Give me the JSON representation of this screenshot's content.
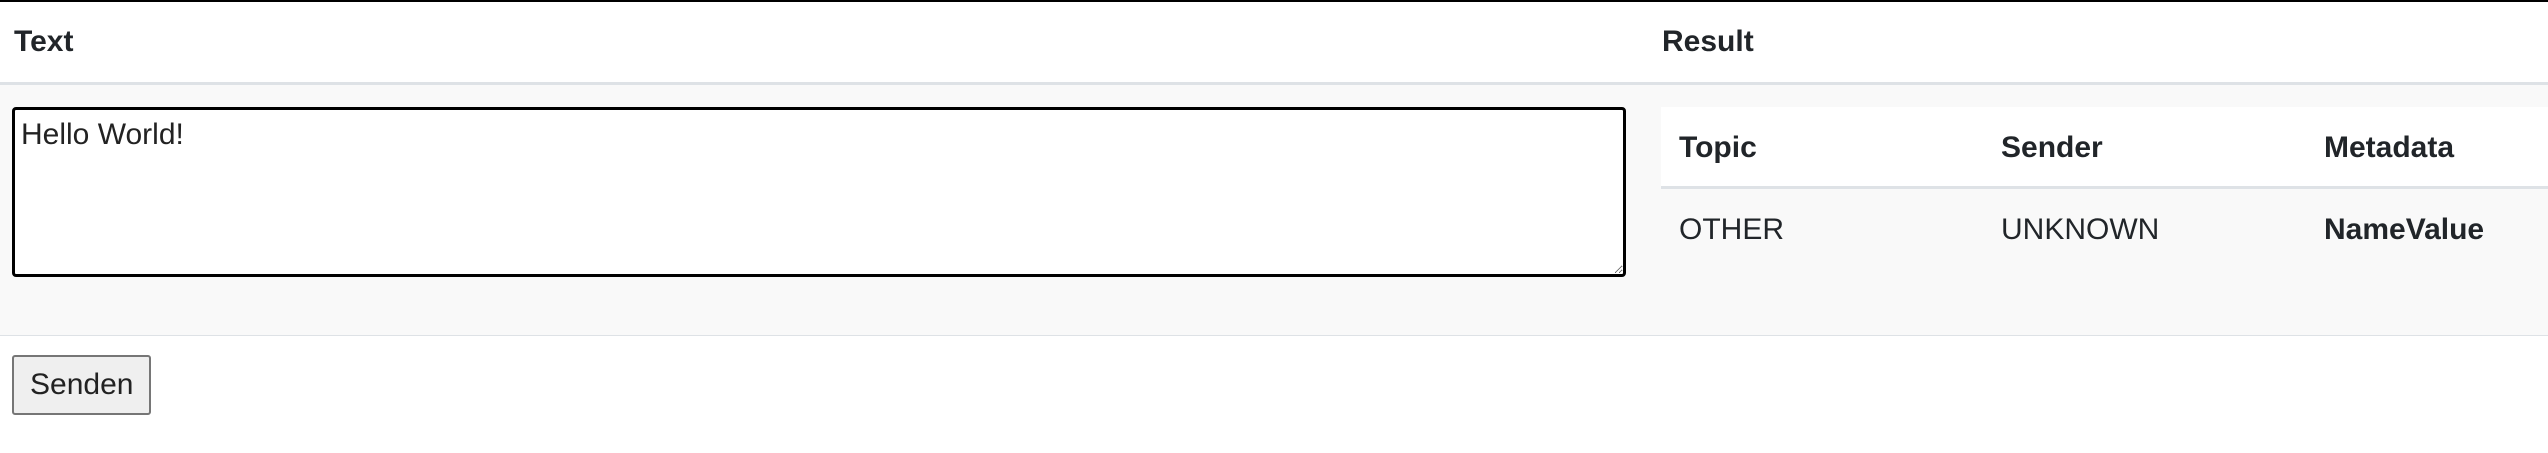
{
  "table": {
    "header_text": "Text",
    "header_result": "Result"
  },
  "input": {
    "value": "Hello World!"
  },
  "result": {
    "columns": [
      "Topic",
      "Sender",
      "Metadata"
    ],
    "row": {
      "topic": "OTHER",
      "sender": "UNKNOWN",
      "metadata_name": "Name",
      "metadata_value": "Value"
    }
  },
  "actions": {
    "send_label": "Senden"
  }
}
